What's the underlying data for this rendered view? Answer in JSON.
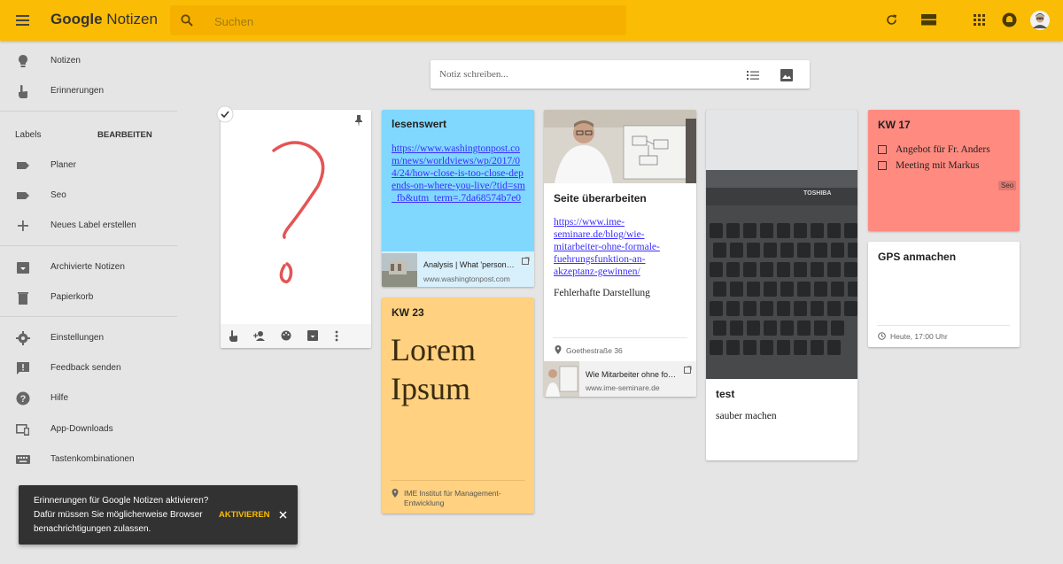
{
  "app": {
    "name_bold": "Google",
    "name_rest": "Notizen"
  },
  "search": {
    "placeholder": "Suchen"
  },
  "sidebar": {
    "items": [
      {
        "label": "Notizen",
        "icon": "bulb-icon"
      },
      {
        "label": "Erinnerungen",
        "icon": "reminder-hand-icon"
      },
      {
        "label": "Planer",
        "icon": "label-icon"
      },
      {
        "label": "Seo",
        "icon": "label-icon"
      },
      {
        "label": "Neues Label erstellen",
        "icon": "plus-icon"
      },
      {
        "label": "Archivierte Notizen",
        "icon": "archive-icon"
      },
      {
        "label": "Papierkorb",
        "icon": "trash-icon"
      },
      {
        "label": "Einstellungen",
        "icon": "gear-icon"
      },
      {
        "label": "Feedback senden",
        "icon": "feedback-icon"
      },
      {
        "label": "Hilfe",
        "icon": "help-icon"
      },
      {
        "label": "App-Downloads",
        "icon": "devices-icon"
      },
      {
        "label": "Tastenkombinationen",
        "icon": "keyboard-icon"
      }
    ],
    "labels_heading": "Labels",
    "labels_edit": "BEARBEITEN"
  },
  "compose": {
    "placeholder": "Notiz schreiben..."
  },
  "notes": {
    "drawing": {
      "content": "drawing of a question mark"
    },
    "lesenswert": {
      "title": "lesenswert",
      "link": "https://www.washingtonpost.com/news/worldviews/wp/2017/04/24/how-close-is-too-close-depends-on-where-you-live/?tid=sm_fb&utm_term=.7da68574b7e0",
      "preview_title": "Analysis | What 'person…",
      "preview_domain": "www.washingtonpost.com"
    },
    "kw23": {
      "title": "KW 23",
      "body": "Lorem Ipsum",
      "location": "IME Institut für Management-Entwicklung"
    },
    "seite": {
      "title": "Seite überarbeiten",
      "link": "https://www.ime-seminare.de/blog/wie-mitarbeiter-ohne-formale-fuehrungsfunktion-an-akzeptanz-gewinnen/",
      "text": "Fehlerhafte Darstellung",
      "location": "Goethestraße 36",
      "preview_title": "Wie Mitarbeiter ohne fo…",
      "preview_domain": "www.ime-seminare.de"
    },
    "test": {
      "title": "test",
      "text": "sauber machen",
      "image_label": "TOSHIBA"
    },
    "kw17": {
      "title": "KW 17",
      "items": [
        "Angebot für Fr. Anders",
        "Meeting mit Markus"
      ],
      "label": "Seo",
      "color": "#ff8a80"
    },
    "gps": {
      "title": "GPS anmachen",
      "reminder": "Heute, 17:00 Uhr"
    }
  },
  "toast": {
    "line1": "Erinnerungen für Google Notizen aktivieren?",
    "line2": "Dafür müssen Sie möglicherweise Browser",
    "line3": "benachrichtigungen zulassen.",
    "action": "AKTIVIEREN"
  },
  "colors": {
    "topbar": "#fbbc05",
    "lesenswert": "#80d8ff",
    "kw23": "#ffd180",
    "kw17": "#ff8a80",
    "accent": "#fbbc05"
  }
}
